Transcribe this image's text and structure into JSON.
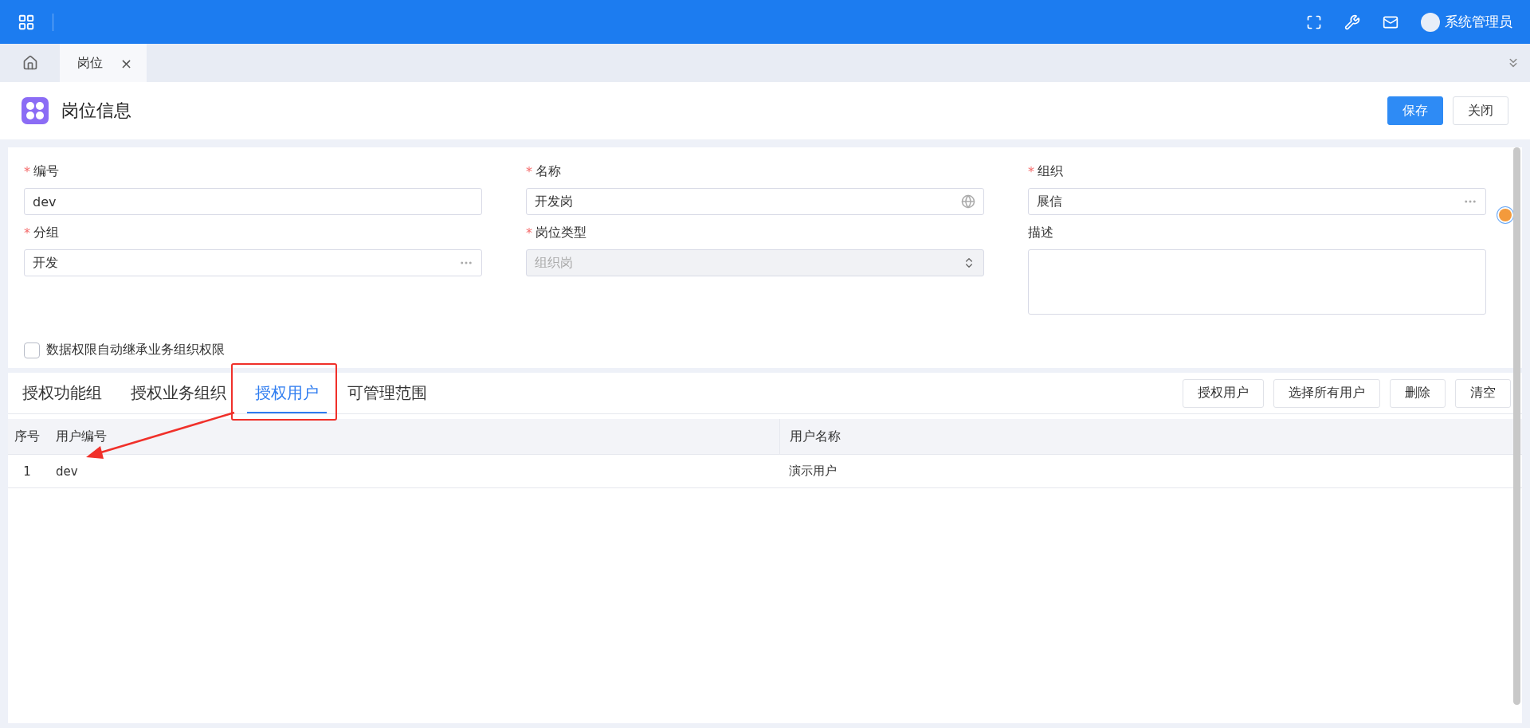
{
  "top_bar": {
    "user": "系统管理员"
  },
  "open_tabs": [
    {
      "label": "岗位",
      "selected": true,
      "close": "×"
    }
  ],
  "page": {
    "title": "岗位信息",
    "buttons": [
      {
        "label": "保存",
        "kind": "primary"
      },
      {
        "label": "关闭",
        "kind": "default"
      }
    ]
  },
  "form": {
    "fields": [
      {
        "label": "编号",
        "required_mark": "*",
        "value": "dev",
        "kind": "text",
        "disabled": false
      },
      {
        "label": "名称",
        "required_mark": "*",
        "value": "开发岗",
        "kind": "language",
        "disabled": false
      },
      {
        "label": "组织",
        "required_mark": "*",
        "value": "展信",
        "kind": "lookup",
        "disabled": false,
        "warning": true
      },
      {
        "label": "分组",
        "required_mark": "*",
        "value": "开发",
        "kind": "lookup",
        "disabled": false
      },
      {
        "label": "岗位类型",
        "required_mark": "*",
        "value": "组织岗",
        "kind": "select",
        "disabled": true
      },
      {
        "label": "描述",
        "kind": "textarea",
        "disabled": false
      }
    ],
    "checkbox": {
      "label": "数据权限自动继承业务组织权限",
      "checked": false
    }
  },
  "detail_tabs": [
    {
      "label": "授权功能组",
      "selected": false
    },
    {
      "label": "授权业务组织",
      "selected": false
    },
    {
      "label": "授权用户",
      "selected": true
    },
    {
      "label": "可管理范围",
      "selected": false
    }
  ],
  "actions": [
    "授权用户",
    "选择所有用户",
    "删除",
    "清空"
  ],
  "table": {
    "columns": [
      "序号",
      "用户编号",
      "用户名称"
    ],
    "rows": [
      {
        "cells": [
          "1",
          "dev",
          "演示用户"
        ]
      }
    ]
  }
}
